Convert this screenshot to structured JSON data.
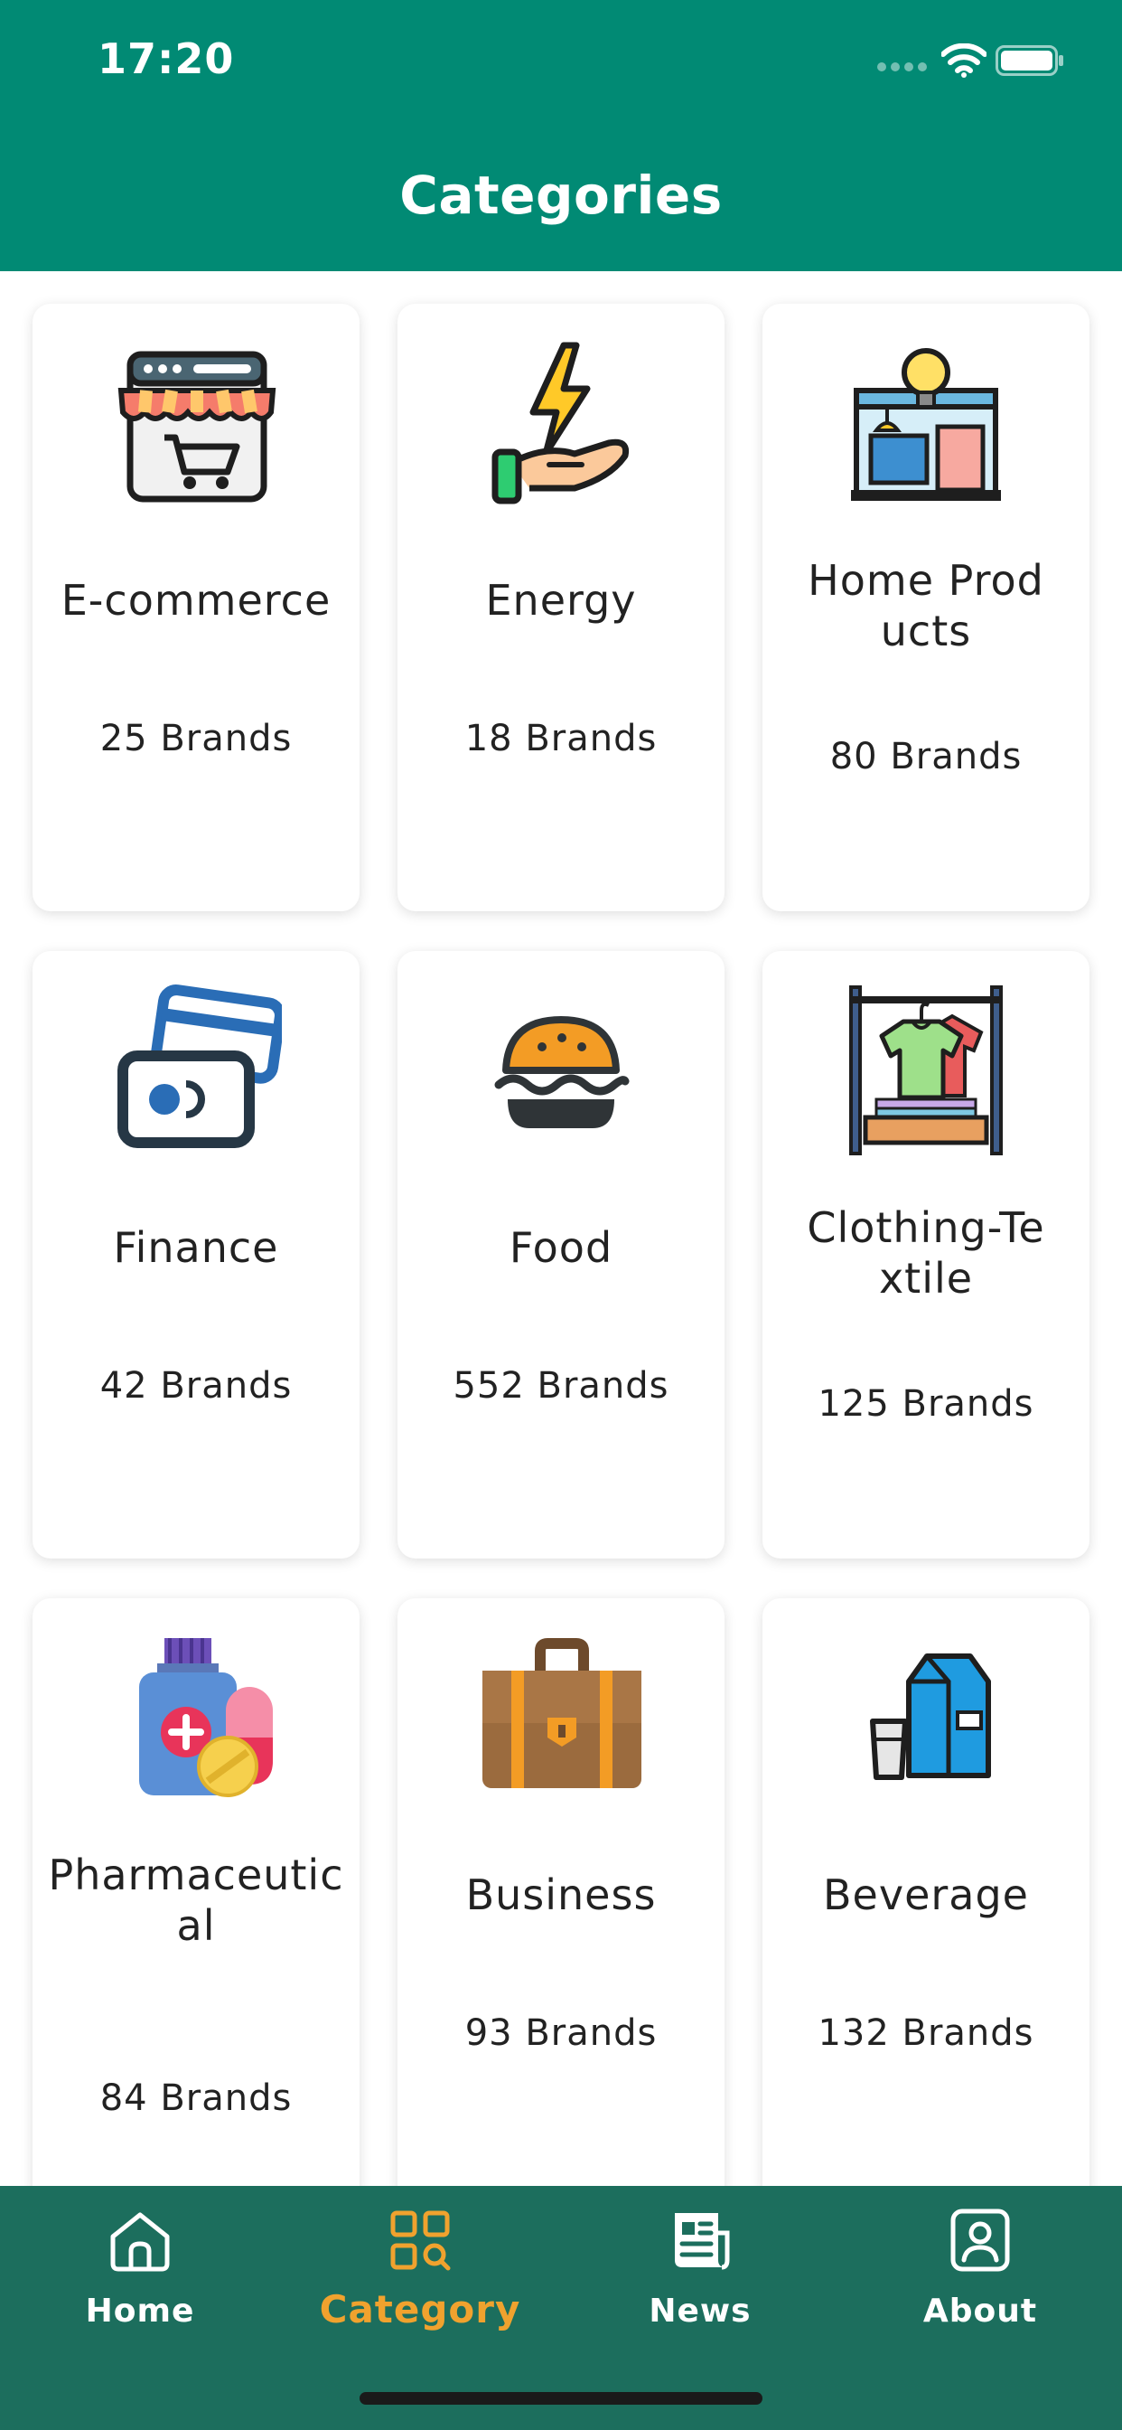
{
  "status_bar": {
    "time": "17:20"
  },
  "header": {
    "title": "Categories"
  },
  "categories": [
    {
      "name": "E-commerce",
      "count": "25 Brands",
      "icon": "online-store-icon"
    },
    {
      "name": "Energy",
      "count": "18 Brands",
      "icon": "energy-hand-icon"
    },
    {
      "name": "Home Products",
      "count": "80 Brands",
      "icon": "home-store-icon"
    },
    {
      "name": "Finance",
      "count": "42 Brands",
      "icon": "credit-cards-icon"
    },
    {
      "name": "Food",
      "count": "552 Brands",
      "icon": "burger-icon"
    },
    {
      "name": "Clothing-Textile",
      "count": "125 Brands",
      "icon": "clothes-rack-icon"
    },
    {
      "name": "Pharmaceutical",
      "count": "84 Brands",
      "icon": "medicine-icon"
    },
    {
      "name": "Business",
      "count": "93 Brands",
      "icon": "briefcase-icon"
    },
    {
      "name": "Beverage",
      "count": "132 Brands",
      "icon": "milk-carton-icon"
    }
  ],
  "tabs": [
    {
      "label": "Home",
      "icon": "home-icon"
    },
    {
      "label": "Category",
      "icon": "category-grid-icon",
      "active": true
    },
    {
      "label": "News",
      "icon": "news-icon"
    },
    {
      "label": "About",
      "icon": "profile-icon"
    }
  ],
  "colors": {
    "header": "#018A74",
    "tabbar": "#1C6E5D",
    "active_tab": "#F0A22E"
  }
}
